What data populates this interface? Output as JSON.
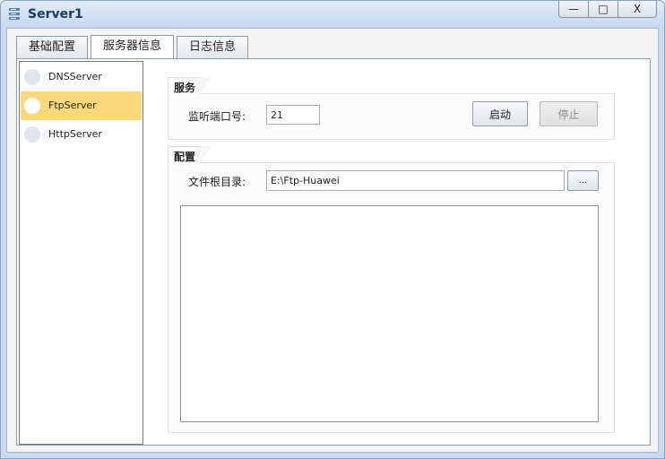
{
  "window": {
    "title": "Server1",
    "controls": {
      "minimize": "—",
      "maximize": "□",
      "close": "X"
    }
  },
  "tabs": [
    {
      "label": "基础配置",
      "active": false
    },
    {
      "label": "服务器信息",
      "active": true
    },
    {
      "label": "日志信息",
      "active": false
    }
  ],
  "server_list": [
    {
      "label": "DNSServer",
      "selected": false
    },
    {
      "label": "FtpServer",
      "selected": true
    },
    {
      "label": "HttpServer",
      "selected": false
    }
  ],
  "service_section": {
    "title": "服务",
    "port_label": "监听端口号:",
    "port_value": "21",
    "start_button": "启动",
    "stop_button": "停止"
  },
  "config_section": {
    "title": "配置",
    "root_label": "文件根目录:",
    "root_value": "E:\\Ftp-Huawei",
    "browse_button": "..."
  },
  "colors": {
    "selected_item": "#fbd87a",
    "window_frame": "#c9daf0"
  }
}
